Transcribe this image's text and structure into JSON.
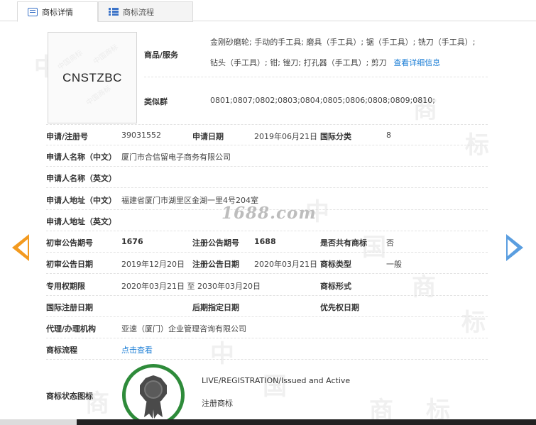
{
  "tabs": [
    {
      "label": "商标详情",
      "icon": "document-icon",
      "active": true
    },
    {
      "label": "商标流程",
      "icon": "list-icon",
      "active": false
    }
  ],
  "watermark": {
    "char_a": "商",
    "char_b": "标",
    "char_c": "中",
    "char_d": "国"
  },
  "logo": {
    "text": "CNSTZBC",
    "seal_text": "中国商标"
  },
  "goods": {
    "label": "商品/服务",
    "text": "金刚砂磨轮; 手动的手工具; 磨具（手工具）; 锯（手工具）; 铣刀（手工具）; 钻头（手工具）; 钳; 锉刀; 打孔器（手工具）; 剪刀",
    "link": "查看详细信息"
  },
  "similar_group": {
    "label": "类似群",
    "value": "0801;0807;0802;0803;0804;0805;0806;0808;0809;0810;"
  },
  "rows": {
    "reg_no_label": "申请/注册号",
    "reg_no": "39031552",
    "apply_date_label": "申请日期",
    "apply_date": "2019年06月21日",
    "intl_class_label": "国际分类",
    "intl_class": "8",
    "applicant_cn_label": "申请人名称（中文）",
    "applicant_cn": "厦门市合信留电子商务有限公司",
    "applicant_en_label": "申请人名称（英文）",
    "address_cn_label": "申请人地址（中文）",
    "address_cn": "福建省厦门市湖里区金湖一里4号204室",
    "address_en_label": "申请人地址（英文）",
    "prelim_no_label": "初审公告期号",
    "prelim_no": "1676",
    "reg_pub_no_label": "注册公告期号",
    "reg_pub_no": "1688",
    "shared_label": "是否共有商标",
    "shared": "否",
    "prelim_date_label": "初审公告日期",
    "prelim_date": "2019年12月20日",
    "reg_pub_date_label": "注册公告日期",
    "reg_pub_date": "2020年03月21日",
    "tm_type_label": "商标类型",
    "tm_type": "一般",
    "exclusive_label": "专用权期限",
    "exclusive": "2020年03月21日 至 2030年03月20日",
    "tm_form_label": "商标形式",
    "intl_reg_date_label": "国际注册日期",
    "later_date_label": "后期指定日期",
    "priority_date_label": "优先权日期",
    "agent_label": "代理/办理机构",
    "agent": "亚速（厦门）企业管理咨询有限公司",
    "flow_label": "商标流程",
    "flow_link": "点击查看",
    "status_label": "商标状态图标",
    "status_en": "LIVE/REGISTRATION/Issued and Active",
    "status_cn": "注册商标"
  },
  "site_watermark": "1688.com",
  "colors": {
    "link": "#1e7fd6",
    "prev_arrow": "#f39a1f",
    "next_arrow": "#5a9ee0",
    "status_ring": "#2e8b3a"
  }
}
